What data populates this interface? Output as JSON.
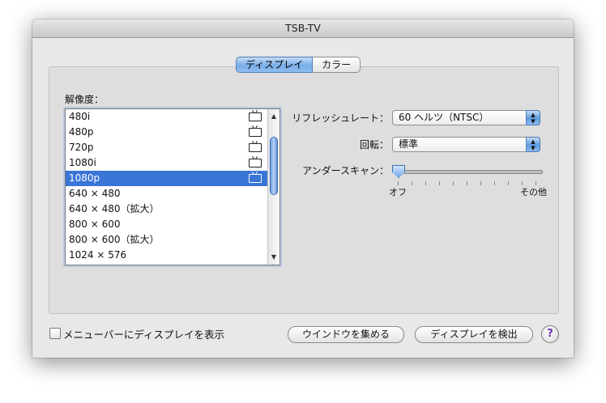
{
  "window": {
    "title": "TSB-TV"
  },
  "tabs": [
    {
      "label": "ディスプレイ",
      "selected": true
    },
    {
      "label": "カラー",
      "selected": false
    }
  ],
  "resolution": {
    "label": "解像度：",
    "items": [
      {
        "label": "480i",
        "tv_icon": true
      },
      {
        "label": "480p",
        "tv_icon": true
      },
      {
        "label": "720p",
        "tv_icon": true
      },
      {
        "label": "1080i",
        "tv_icon": true
      },
      {
        "label": "1080p",
        "tv_icon": true,
        "selected": true
      },
      {
        "label": "640 × 480",
        "tv_icon": false
      },
      {
        "label": "640 × 480（拡大）",
        "tv_icon": false
      },
      {
        "label": "800 × 600",
        "tv_icon": false
      },
      {
        "label": "800 × 600（拡大）",
        "tv_icon": false
      },
      {
        "label": "1024 × 576",
        "tv_icon": false
      }
    ]
  },
  "refresh_rate": {
    "label": "リフレッシュレート：",
    "value": "60 ヘルツ（NTSC）"
  },
  "rotation": {
    "label": "回転：",
    "value": "標準"
  },
  "underscan": {
    "label": "アンダースキャン：",
    "min_label": "オフ",
    "max_label": "その他",
    "value": 0
  },
  "footer": {
    "menubar_checkbox_label": "メニューバーにディスプレイを表示",
    "menubar_checked": false,
    "gather_windows_button": "ウインドウを集める",
    "detect_displays_button": "ディスプレイを検出",
    "help_glyph": "?"
  },
  "colors": {
    "selection": "#3875d7",
    "accent": "#6ea6e8"
  }
}
